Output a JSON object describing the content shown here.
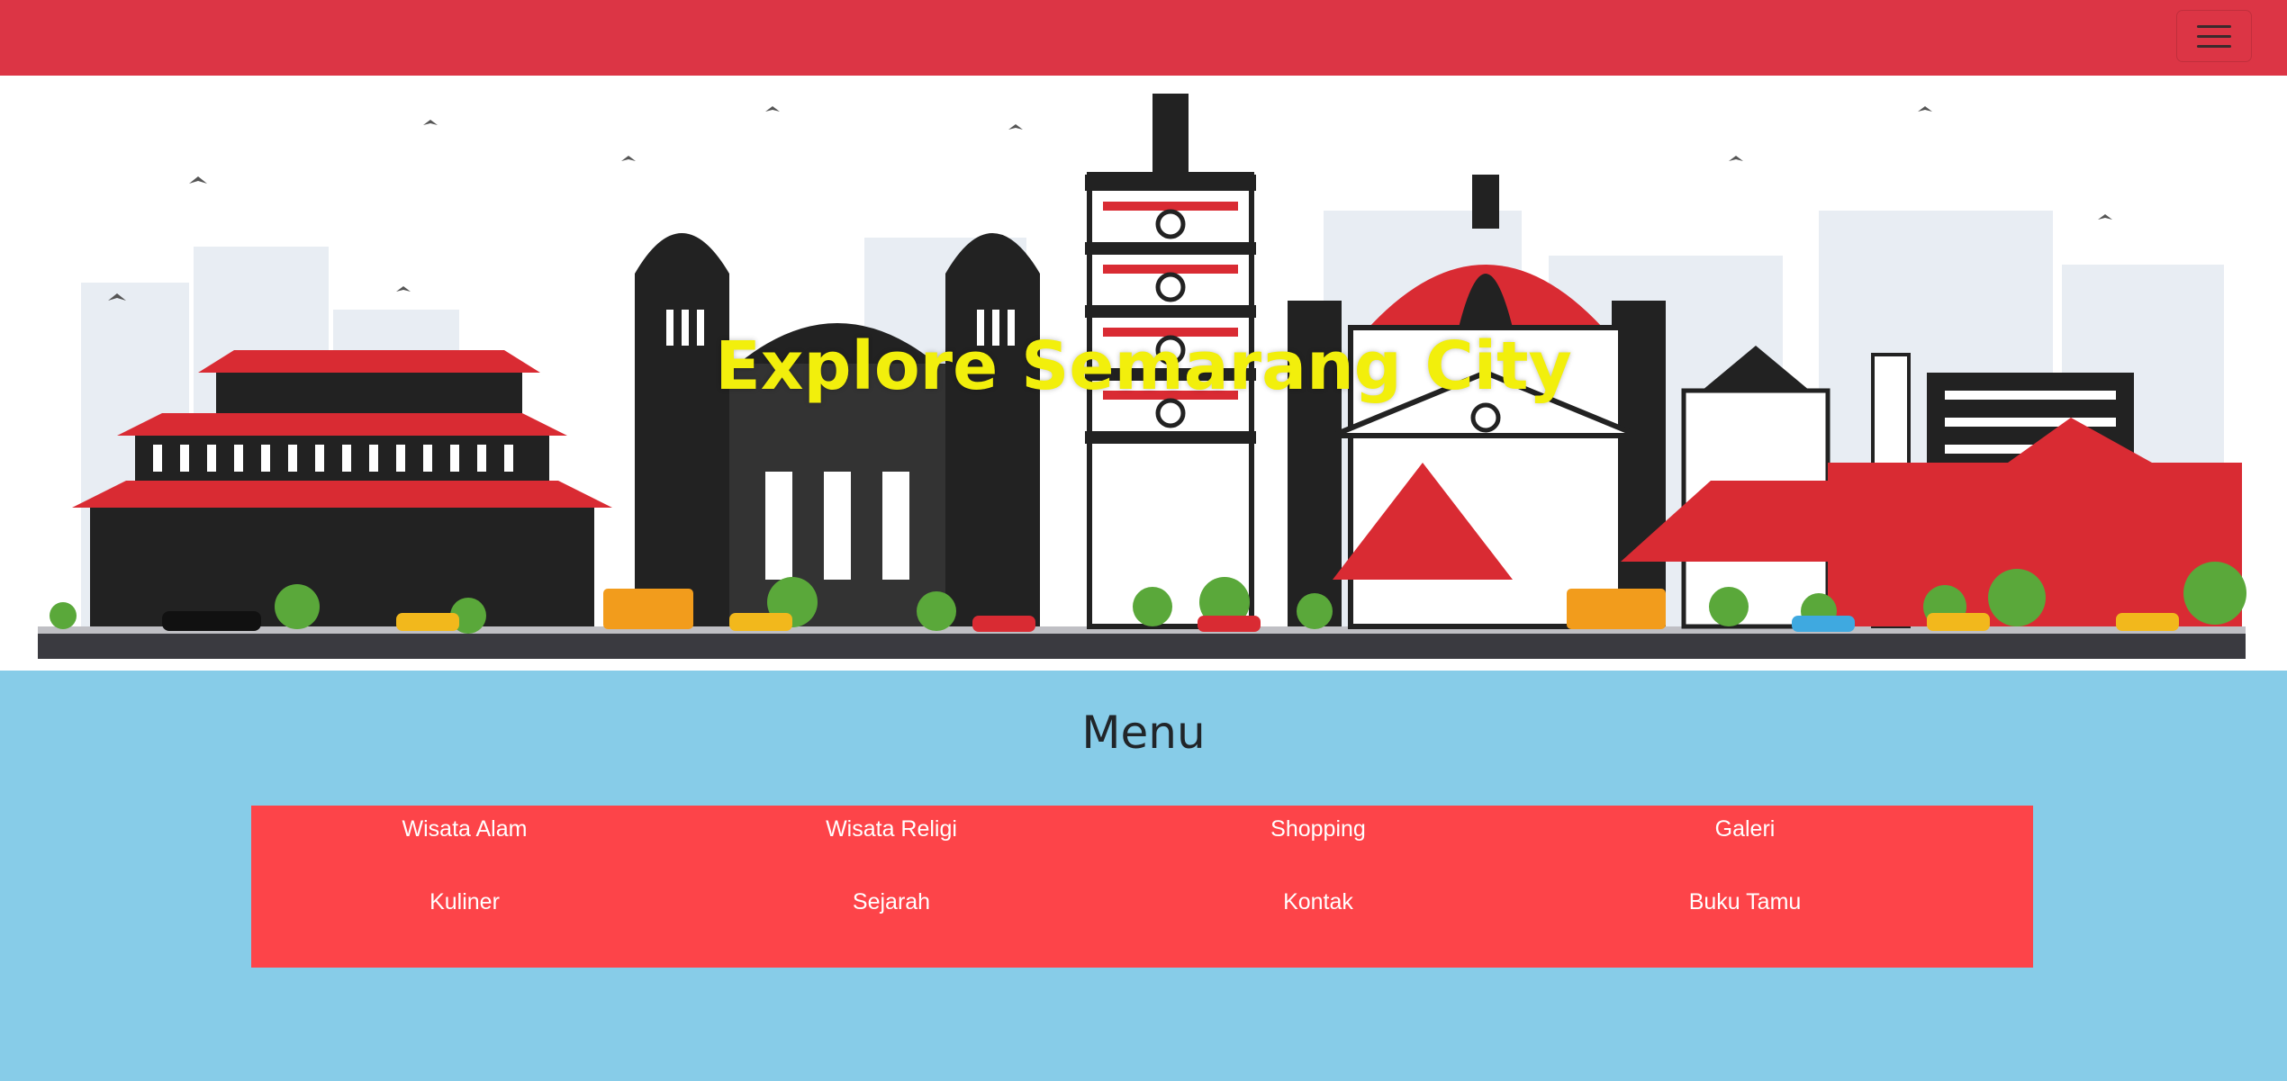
{
  "navbar": {
    "color": "#dc3545",
    "toggler_icon": "hamburger-menu-icon"
  },
  "hero": {
    "title": "Explore Semarang City",
    "title_color": "#f2ef0c"
  },
  "menu": {
    "heading": "Menu",
    "background": "#fd4449",
    "items": [
      {
        "label": "Wisata Alam"
      },
      {
        "label": "Wisata Religi"
      },
      {
        "label": "Shopping"
      },
      {
        "label": "Galeri"
      },
      {
        "label": "Kuliner"
      },
      {
        "label": "Sejarah"
      },
      {
        "label": "Kontak"
      },
      {
        "label": "Buku Tamu"
      }
    ]
  },
  "page_background": "#87cce8"
}
